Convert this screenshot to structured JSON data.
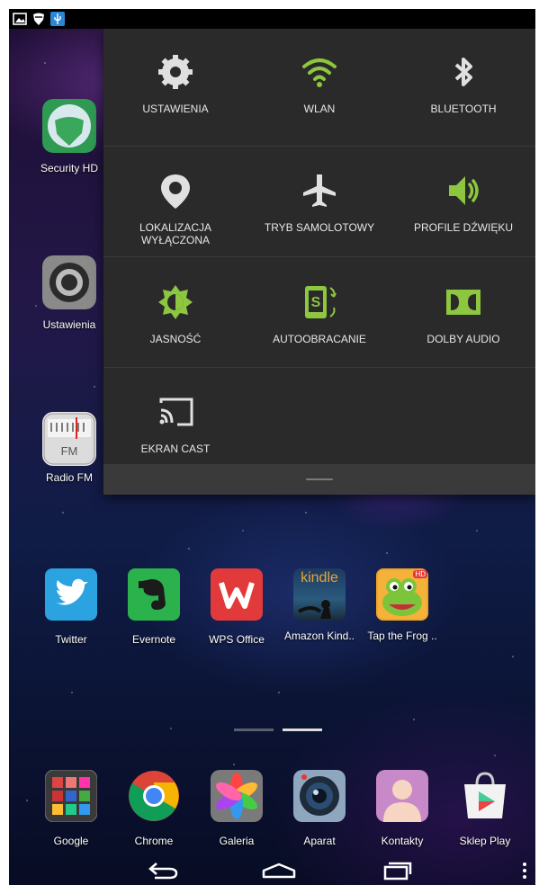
{
  "status_bar": {
    "icons": [
      "image-icon",
      "shield-icon",
      "usb-icon"
    ]
  },
  "side_icons": [
    {
      "name": "security-hd",
      "label": "Security HD"
    },
    {
      "name": "ustawienia",
      "label": "Ustawienia"
    },
    {
      "name": "radio-fm",
      "label": "Radio FM",
      "badge": "FM"
    }
  ],
  "quick_settings": {
    "tiles": [
      {
        "label": "USTAWIENIA",
        "icon": "gear-icon"
      },
      {
        "label": "WLAN",
        "icon": "wifi-icon"
      },
      {
        "label": "BLUETOOTH",
        "icon": "bluetooth-icon"
      },
      {
        "label_line1": "LOKALIZACJA",
        "label_line2": "WYŁĄCZONA",
        "icon": "location-icon"
      },
      {
        "label": "TRYB SAMOLOTOWY",
        "icon": "airplane-icon"
      },
      {
        "label": "PROFILE DŹWIĘKU",
        "icon": "speaker-icon"
      },
      {
        "label": "JASNOŚĆ",
        "icon": "brightness-icon"
      },
      {
        "label": "AUTOOBRACANIE",
        "icon": "auto-rotate-icon"
      },
      {
        "label": "DOLBY AUDIO",
        "icon": "dolby-icon"
      },
      {
        "label": "EKRAN CAST",
        "icon": "cast-icon"
      }
    ],
    "accent": "#8dc63f"
  },
  "apps": [
    {
      "label": "Twitter"
    },
    {
      "label": "Evernote"
    },
    {
      "label": "WPS Office"
    },
    {
      "label": "Amazon Kind..",
      "badge": "kindle"
    },
    {
      "label": "Tap the Frog ..",
      "badge": "HD"
    }
  ],
  "dock": [
    {
      "label": "Google"
    },
    {
      "label": "Chrome"
    },
    {
      "label": "Galeria"
    },
    {
      "label": "Aparat"
    },
    {
      "label": "Kontakty"
    },
    {
      "label": "Sklep Play"
    }
  ],
  "navbar": {
    "icons": [
      "back-icon",
      "home-icon",
      "recents-icon",
      "overflow-menu-icon"
    ]
  }
}
